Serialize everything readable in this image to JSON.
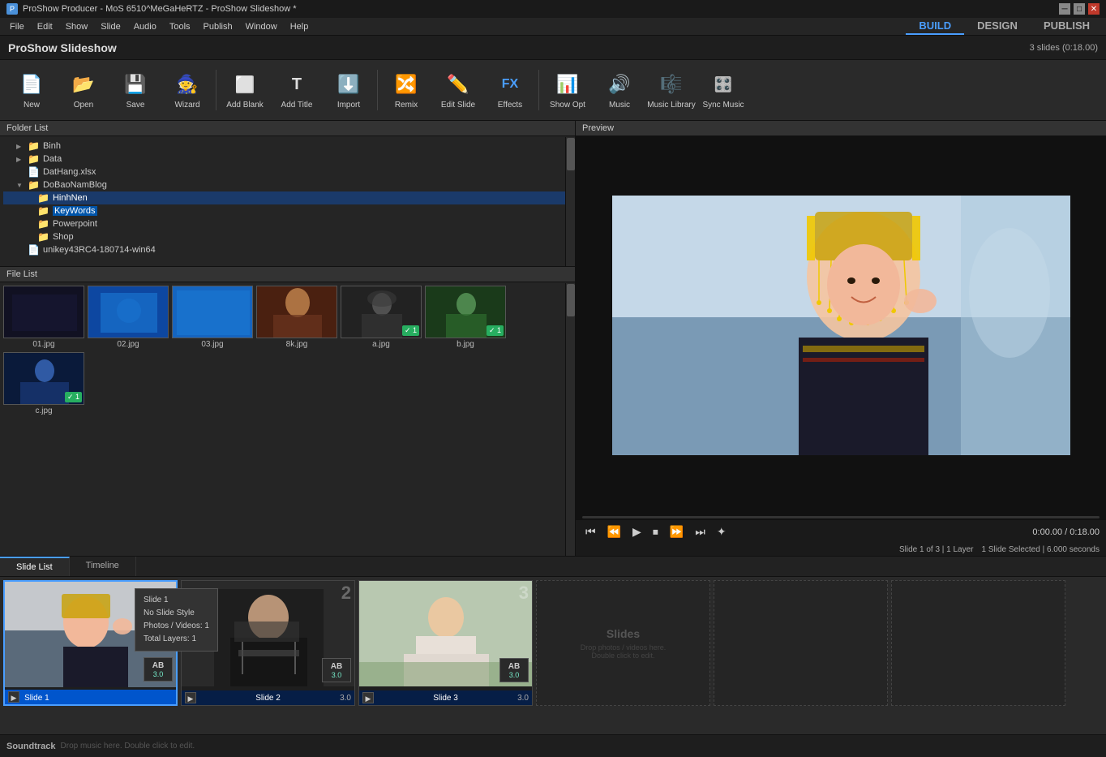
{
  "titlebar": {
    "text": "ProShow Producer - MoS 6510^MeGaHeRTZ - ProShow Slideshow *",
    "controls": [
      "─",
      "□",
      "✕"
    ]
  },
  "menubar": {
    "items": [
      "File",
      "Edit",
      "Show",
      "Slide",
      "Audio",
      "Tools",
      "Publish",
      "Window",
      "Help"
    ],
    "nav": {
      "build": "BUILD",
      "design": "DESIGN",
      "publish": "PUBLISH"
    }
  },
  "appheader": {
    "title": "ProShow Slideshow",
    "slideinfo": "3 slides (0:18.00)"
  },
  "toolbar": {
    "buttons": [
      {
        "id": "new",
        "label": "New",
        "icon": "📄"
      },
      {
        "id": "open",
        "label": "Open",
        "icon": "📂"
      },
      {
        "id": "save",
        "label": "Save",
        "icon": "💾"
      },
      {
        "id": "wizard",
        "label": "Wizard",
        "icon": "🧙"
      },
      {
        "id": "add-blank",
        "label": "Add Blank",
        "icon": "➕"
      },
      {
        "id": "add-title",
        "label": "Add Title",
        "icon": "T"
      },
      {
        "id": "import",
        "label": "Import",
        "icon": "⬇"
      },
      {
        "id": "remix",
        "label": "Remix",
        "icon": "🔀"
      },
      {
        "id": "edit-slide",
        "label": "Edit Slide",
        "icon": "✏"
      },
      {
        "id": "effects",
        "label": "Effects",
        "icon": "FX"
      },
      {
        "id": "show-opt",
        "label": "Show Opt",
        "icon": "📊"
      },
      {
        "id": "music",
        "label": "Music",
        "icon": "🎵"
      },
      {
        "id": "music-library",
        "label": "Music Library",
        "icon": "🎼"
      },
      {
        "id": "sync-music",
        "label": "Sync Music",
        "icon": "🎛"
      }
    ]
  },
  "folderlist": {
    "header": "Folder List",
    "items": [
      {
        "indent": 1,
        "arrow": "▶",
        "icon": "📁",
        "label": "Binh",
        "selected": false
      },
      {
        "indent": 1,
        "arrow": "▶",
        "icon": "📁",
        "label": "Data",
        "selected": false
      },
      {
        "indent": 1,
        "arrow": "",
        "icon": "📄",
        "label": "DatHang.xlsx",
        "selected": false
      },
      {
        "indent": 1,
        "arrow": "▼",
        "icon": "📁",
        "label": "DoBaoNamBlog",
        "selected": false
      },
      {
        "indent": 2,
        "arrow": "",
        "icon": "📁",
        "label": "HinhNen",
        "selected": false,
        "highlight": true
      },
      {
        "indent": 2,
        "arrow": "",
        "icon": "📁",
        "label": "KeyWords",
        "selected": true
      },
      {
        "indent": 2,
        "arrow": "",
        "icon": "📁",
        "label": "Powerpoint",
        "selected": false
      },
      {
        "indent": 2,
        "arrow": "",
        "icon": "📁",
        "label": "Shop",
        "selected": false
      },
      {
        "indent": 1,
        "arrow": "",
        "icon": "📄",
        "label": "unikey43RC4-180714-win64",
        "selected": false
      }
    ]
  },
  "filelist": {
    "header": "File List",
    "files": [
      {
        "name": "01.jpg",
        "type": "dark",
        "checked": false
      },
      {
        "name": "02.jpg",
        "type": "blue1",
        "checked": false
      },
      {
        "name": "03.jpg",
        "type": "blue2",
        "checked": false
      },
      {
        "name": "8k.jpg",
        "type": "portrait1",
        "checked": false
      },
      {
        "name": "a.jpg",
        "type": "portrait2",
        "checked": true
      },
      {
        "name": "b.jpg",
        "type": "portrait3",
        "checked": true
      },
      {
        "name": "c.jpg",
        "type": "blue3",
        "checked": true
      }
    ]
  },
  "preview": {
    "header": "Preview",
    "time": "0:00.00 / 0:18.00",
    "slide_info": "Slide 1 of 3  |  1 Layer",
    "slide_selected": "1 Slide Selected  |  6.000 seconds"
  },
  "slidetabs": {
    "tabs": [
      "Slide List",
      "Timeline"
    ],
    "active": "Slide List"
  },
  "slides": [
    {
      "id": 1,
      "label": "Slide 1",
      "selected": true,
      "num": "",
      "time": "3.0",
      "photo_type": "portrait_dark"
    },
    {
      "id": 2,
      "label": "Slide 2",
      "selected": false,
      "num": "2",
      "time": "3.0",
      "photo_type": "musician"
    },
    {
      "id": 3,
      "label": "Slide 3",
      "selected": false,
      "num": "3",
      "time": "3.0",
      "photo_type": "sitting"
    },
    {
      "id": 4,
      "label": "Slides",
      "empty": true,
      "hint": "Drop photos / videos here.\nDouble click to edit."
    },
    {
      "id": 5,
      "label": "",
      "empty": true,
      "hint": ""
    },
    {
      "id": 6,
      "label": "",
      "empty": true,
      "hint": ""
    }
  ],
  "tooltip": {
    "slide_label": "Slide 1",
    "no_slide_style": "No Slide Style",
    "photos_videos": "Photos / Videos: 1",
    "total_layers": "Total Layers: 1"
  },
  "soundtrack": {
    "label": "Soundtrack",
    "hint": "Drop music here. Double click to edit."
  }
}
